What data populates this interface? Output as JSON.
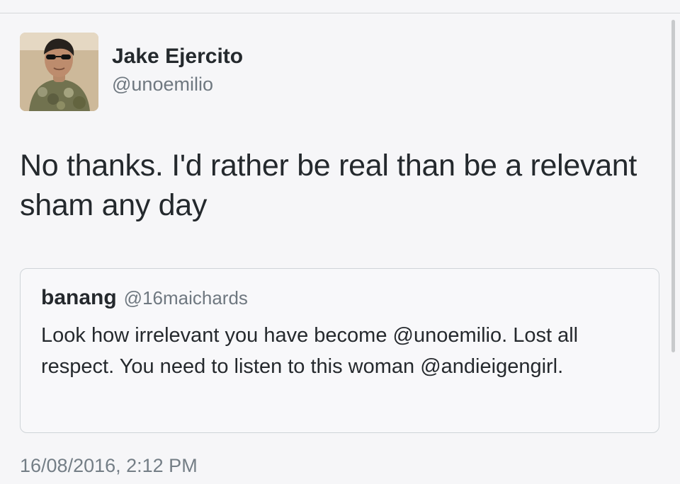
{
  "tweet": {
    "author": {
      "name": "Jake Ejercito",
      "handle": "@unoemilio",
      "avatar_icon": "profile-photo"
    },
    "text": "No thanks. I'd rather be real than be a relevant sham any day",
    "quoted_tweet": {
      "name": "banang",
      "handle": "@16maichards",
      "text": "Look how irrelevant you have become @unoemilio. Lost all respect. You need to listen to this woman @andieigengirl."
    },
    "timestamp": "16/08/2016, 2:12 PM"
  }
}
